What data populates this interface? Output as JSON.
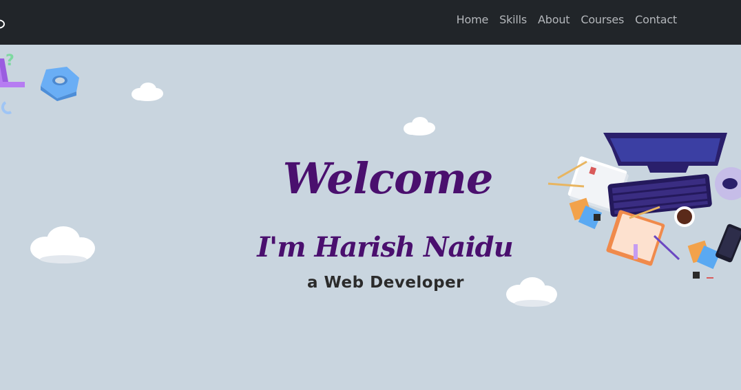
{
  "nav": {
    "links": [
      {
        "label": "Home"
      },
      {
        "label": "Skills"
      },
      {
        "label": "About"
      },
      {
        "label": "Courses"
      },
      {
        "label": "Contact"
      }
    ]
  },
  "hero": {
    "welcome": "Welcome",
    "name": "I'm Harish Naidu",
    "role": "a Web Developer"
  },
  "colors": {
    "navbar_bg": "#212529",
    "page_bg": "#c9d5df",
    "heading": "#4a0f6e",
    "nav_text": "#b4b7bb"
  },
  "icons": [
    "brand-logo-icon",
    "letters-decoration-icon",
    "hex-nut-icon",
    "cloud-icon",
    "desk-workspace-illustration"
  ]
}
